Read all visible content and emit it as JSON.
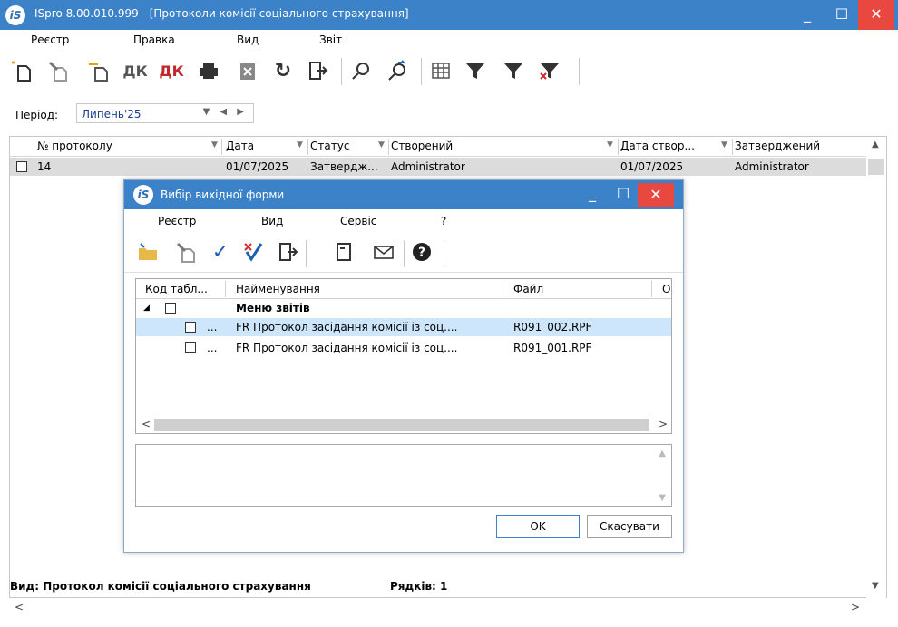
{
  "window": {
    "title": "ISpro 8.00.010.999 - [Протоколи комісії соціального страхування]",
    "logo_text": "iS",
    "minimize": "_",
    "maximize": "☐",
    "close": "✕"
  },
  "menu": [
    "Реєстр",
    "Правка",
    "Вид",
    "Звіт"
  ],
  "toolbar_icons": [
    "new-record-icon",
    "edit-record-icon",
    "copy-record-icon",
    "debit-credit-icon",
    "debit-credit-red-icon",
    "print-icon",
    "export-icon",
    "refresh-icon",
    "exit-icon",
    "search-icon",
    "find-next-icon",
    "grid-icon",
    "filter-icon",
    "filter-set-icon",
    "filter-clear-icon"
  ],
  "period": {
    "label": "Період:",
    "value": "Липень'25"
  },
  "grid": {
    "columns": [
      "№ протоколу",
      "Дата",
      "Статус",
      "Створений",
      "Дата створ...",
      "Затверджений"
    ],
    "rows": [
      {
        "number": "14",
        "date": "01/07/2025",
        "status": "Затвердж...",
        "created_by": "Administrator",
        "created_date": "01/07/2025",
        "approved_by": "Administrator"
      }
    ]
  },
  "status_bar": {
    "view": "Вид: Протокол комісії соціального страхування",
    "rows": "Рядків: 1"
  },
  "dialog": {
    "title": "Вибір вихідної форми",
    "logo_text": "iS",
    "menu": [
      "Реєстр",
      "Вид",
      "Сервіс",
      "?"
    ],
    "toolbar_icons": [
      "open-folder-icon",
      "edit-icon",
      "check-icon",
      "uncheck-icon",
      "exit-icon",
      "form-icon",
      "mail-icon",
      "help-icon"
    ],
    "columns": [
      "Код табл...",
      "Найменування",
      "Файл",
      "О"
    ],
    "group_label": "Меню звітів",
    "rows": [
      {
        "code": "...",
        "name": "FR Протокол засідання комісії із соц....",
        "file": "R091_002.RPF"
      },
      {
        "code": "...",
        "name": "FR Протокол засідання комісії із соц....",
        "file": "R091_001.RPF"
      }
    ],
    "ok_label": "OK",
    "cancel_label": "Скасувати"
  }
}
